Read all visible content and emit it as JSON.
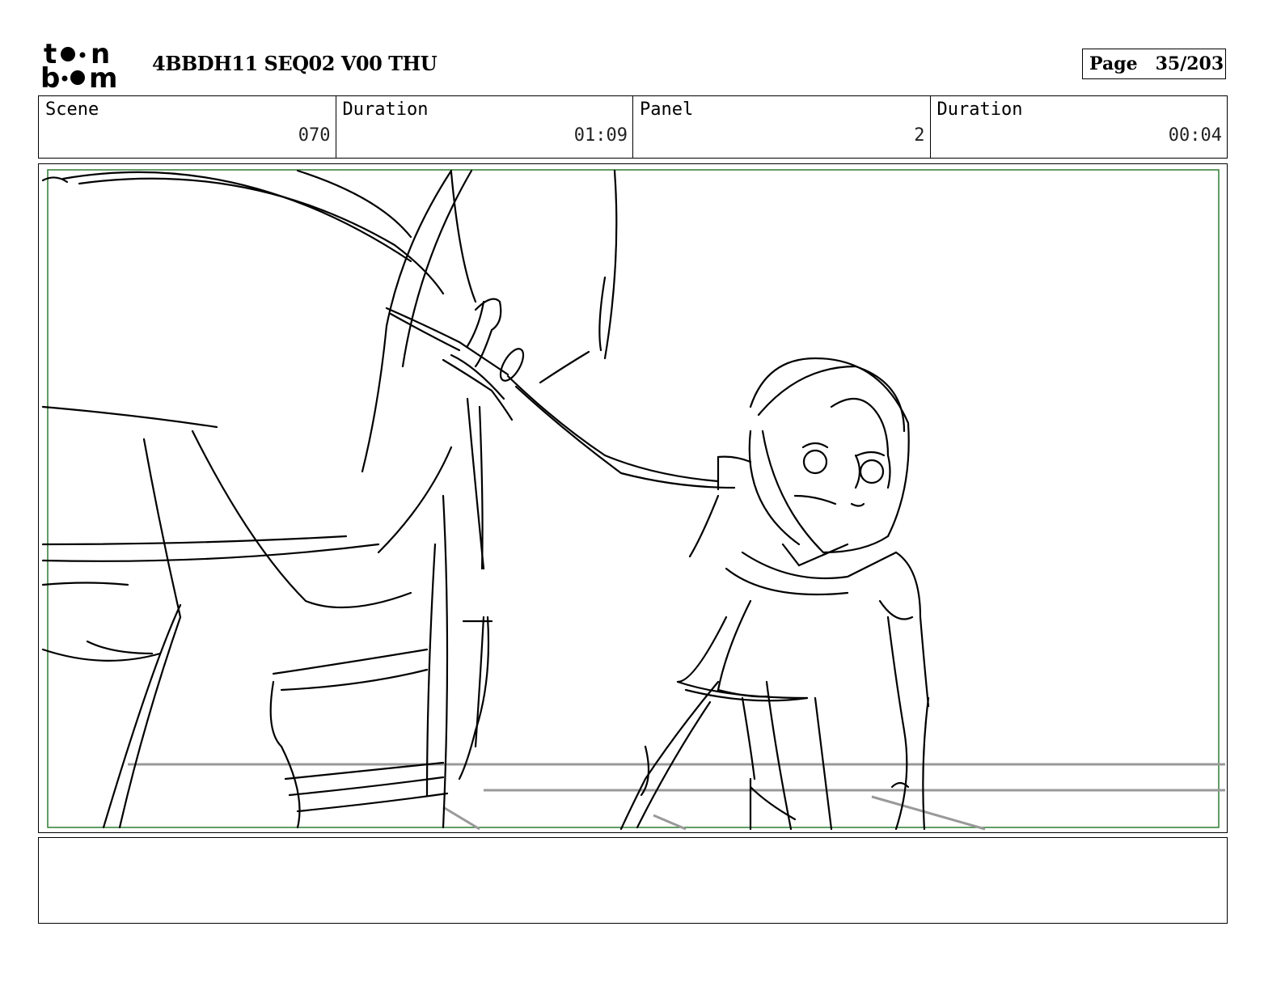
{
  "header": {
    "logo_text": "toon boom",
    "title": "4BBDH11 SEQ02 V00 THU",
    "page_label": "Page",
    "page_value": "35/203"
  },
  "info": {
    "scene_label": "Scene",
    "scene_value": "070",
    "scene_duration_label": "Duration",
    "scene_duration_value": "01:09",
    "panel_label": "Panel",
    "panel_value": "2",
    "panel_duration_label": "Duration",
    "panel_duration_value": "00:04"
  },
  "panel": {
    "safe_frame_color": "#2e7d32",
    "floor_line_color": "#999999"
  },
  "notes": {
    "text": ""
  }
}
